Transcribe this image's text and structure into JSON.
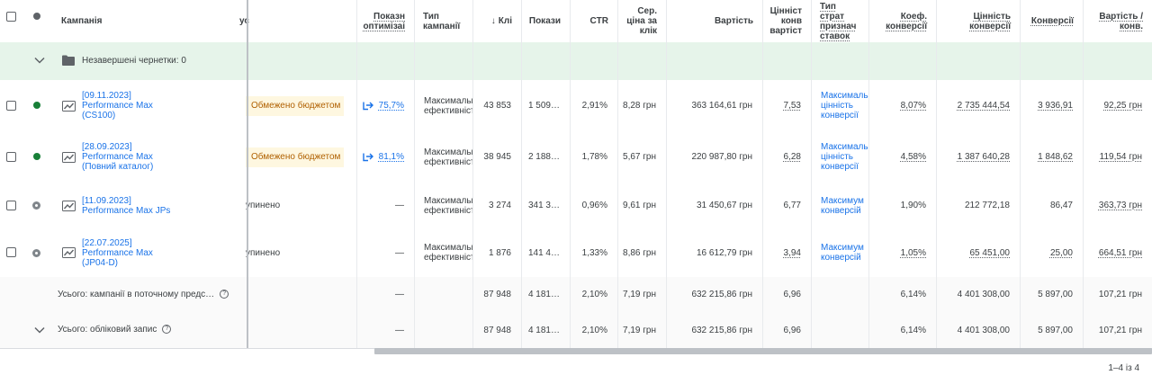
{
  "header": {
    "campaign_label": "Кампанія",
    "status_partial": "ус",
    "columns": [
      {
        "key": "opt",
        "label": "Показн оптимізаі",
        "align": "r",
        "ul": true
      },
      {
        "key": "type",
        "label": "Тип кампанії",
        "align": "l",
        "ul": false
      },
      {
        "key": "clicks",
        "label": "Клі",
        "align": "r",
        "ul": false,
        "sort": "↓"
      },
      {
        "key": "impr",
        "label": "Покази",
        "align": "r",
        "ul": false
      },
      {
        "key": "ctr",
        "label": "CTR",
        "align": "r",
        "ul": false
      },
      {
        "key": "cpc",
        "label": "Сер. ціна за клік",
        "align": "r",
        "ul": false
      },
      {
        "key": "cost",
        "label": "Вартість",
        "align": "r",
        "ul": false
      },
      {
        "key": "convval",
        "label": "Цінніст конв вартіст",
        "align": "r",
        "ul": false
      },
      {
        "key": "bid",
        "label": "Тип страт признач ставок",
        "align": "l",
        "ul": true
      },
      {
        "key": "convrate",
        "label": "Коеф. конверсії",
        "align": "r",
        "ul": true
      },
      {
        "key": "valueconv",
        "label": "Цінність конверсії",
        "align": "r",
        "ul": true
      },
      {
        "key": "conv",
        "label": "Конверсії",
        "align": "r",
        "ul": true
      },
      {
        "key": "costconv",
        "label": "Вартість / конв.",
        "align": "r",
        "ul": true
      }
    ]
  },
  "group_row": {
    "label": "Незавершені чернетки: 0"
  },
  "rows": [
    {
      "status": "green",
      "campaign_lines": [
        "[09.11.2023]",
        "Performance Max",
        "(CS100)"
      ],
      "status_text": "",
      "badge": "Обмежено бюджетом",
      "opt": "75,7%",
      "type": "Максимальн ефективніст",
      "clicks": "43 853",
      "impr": "1 509…",
      "ctr": "2,91%",
      "cpc": "8,28 грн",
      "cost": "363 164,61 грн",
      "convval": "7,53",
      "bid": "Максимальн цінність конверсії",
      "convrate": "8,07%",
      "valueconv": "2 735 444,54",
      "conv": "3 936,91",
      "costconv": "92,25 грн"
    },
    {
      "status": "green",
      "campaign_lines": [
        "[28.09.2023]",
        "Performance Max",
        "(Повний каталог)"
      ],
      "status_text": "",
      "badge": "Обмежено бюджетом",
      "opt": "81,1%",
      "type": "Максимальн ефективніст",
      "clicks": "38 945",
      "impr": "2 188…",
      "ctr": "1,78%",
      "cpc": "5,67 грн",
      "cost": "220 987,80 грн",
      "convval": "6,28",
      "bid": "Максимальн цінність конверсії",
      "convrate": "4,58%",
      "valueconv": "1 387 640,28",
      "conv": "1 848,62",
      "costconv": "119,54 грн"
    },
    {
      "status": "grey",
      "campaign_lines": [
        "[11.09.2023]",
        "Performance Max JPs"
      ],
      "status_text": "упинено",
      "badge": "",
      "opt": "—",
      "type": "Максимальн ефективніст",
      "clicks": "3 274",
      "impr": "341 3…",
      "ctr": "0,96%",
      "cpc": "9,61 грн",
      "cost": "31 450,67 грн",
      "convval": "6,77",
      "bid": "Максимум конверсій",
      "convrate": "1,90%",
      "valueconv": "212 772,18",
      "conv": "86,47",
      "costconv": "363,73 грн"
    },
    {
      "status": "grey",
      "campaign_lines": [
        "[22.07.2025]",
        "Performance Max",
        "(JP04-D)"
      ],
      "status_text": "упинено",
      "badge": "",
      "opt": "—",
      "type": "Максимальн ефективніст",
      "clicks": "1 876",
      "impr": "141 4…",
      "ctr": "1,33%",
      "cpc": "8,86 грн",
      "cost": "16 612,79 грн",
      "convval": "3,94",
      "bid": "Максимум конверсій",
      "convrate": "1,05%",
      "valueconv": "65 451,00",
      "conv": "25,00",
      "costconv": "664,51 грн"
    }
  ],
  "totals": [
    {
      "label": "Усього: кампанії в поточному предс…",
      "opt": "—",
      "clicks": "87 948",
      "impr": "4 181…",
      "ctr": "2,10%",
      "cpc": "7,19 грн",
      "cost": "632 215,86 грн",
      "convval": "6,96",
      "convrate": "6,14%",
      "valueconv": "4 401 308,00",
      "conv": "5 897,00",
      "costconv": "107,21 грн"
    },
    {
      "label": "Усього: обліковий запис",
      "opt": "—",
      "clicks": "87 948",
      "impr": "4 181…",
      "ctr": "2,10%",
      "cpc": "7,19 грн",
      "cost": "632 215,86 грн",
      "convval": "6,96",
      "convrate": "6,14%",
      "valueconv": "4 401 308,00",
      "conv": "5 897,00",
      "costconv": "107,21 грн"
    }
  ],
  "pager": {
    "label": "1–4 із 4"
  },
  "colors": {
    "link": "#1a73e8",
    "green": "#188038",
    "badge_bg": "#fef7e0",
    "badge_text": "#b06000",
    "group_bg": "#e6f4ea"
  }
}
